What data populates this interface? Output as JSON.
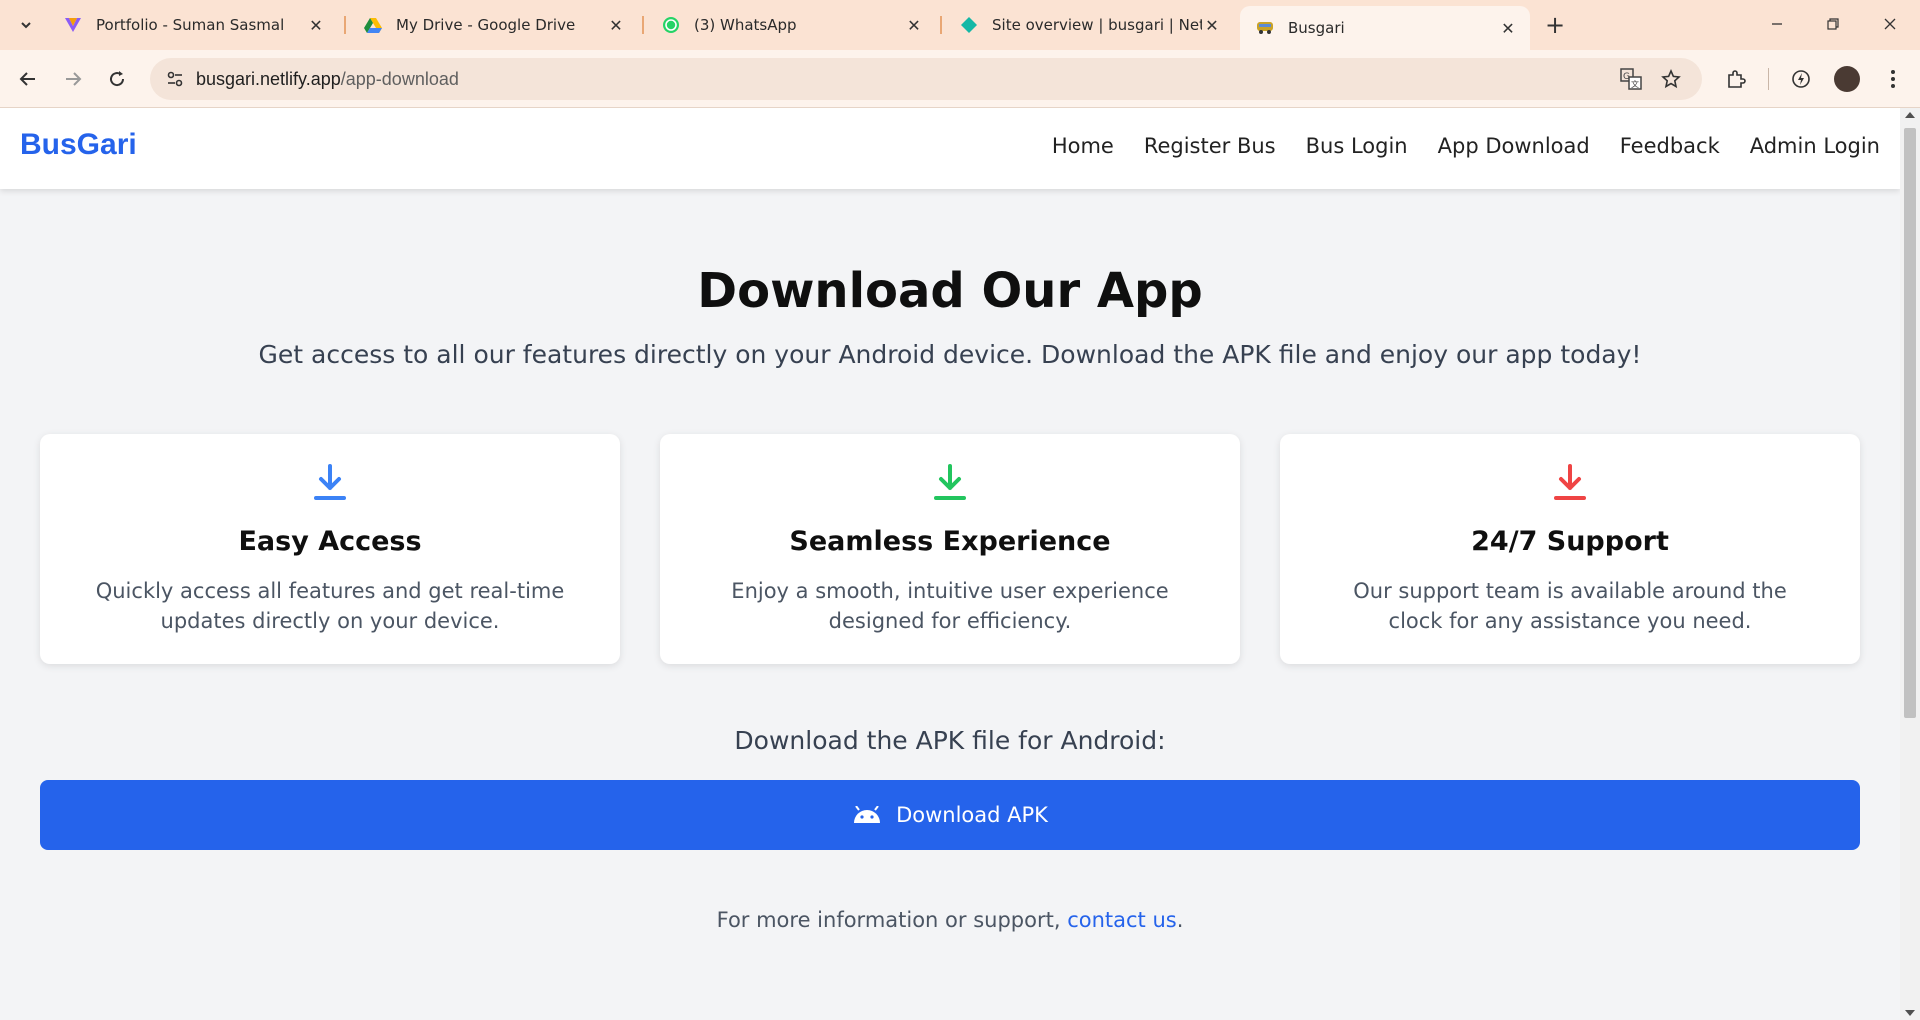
{
  "browser": {
    "tabs": [
      {
        "title": "Portfolio - Suman Sasmal",
        "favicon": "portfolio-v-icon",
        "active": false
      },
      {
        "title": "My Drive - Google Drive",
        "favicon": "google-drive-icon",
        "active": false
      },
      {
        "title": "(3) WhatsApp",
        "favicon": "whatsapp-icon",
        "active": false
      },
      {
        "title": "Site overview | busgari | Netlify",
        "favicon": "netlify-icon",
        "active": false
      },
      {
        "title": "Busgari",
        "favicon": "bus-icon",
        "active": true
      }
    ],
    "url_host": "busgari.netlify.app",
    "url_path": "/app-download"
  },
  "site": {
    "brand": "BusGari",
    "nav": [
      "Home",
      "Register Bus",
      "Bus Login",
      "App Download",
      "Feedback",
      "Admin Login"
    ],
    "hero_title": "Download Our App",
    "hero_subtitle": "Get access to all our features directly on your Android device. Download the APK file and enjoy our app today!",
    "cards": [
      {
        "title": "Easy Access",
        "text": "Quickly access all features and get real-time updates directly on your device.",
        "icon": "download-icon",
        "color": "#3b82f6"
      },
      {
        "title": "Seamless Experience",
        "text": "Enjoy a smooth, intuitive user experience designed for efficiency.",
        "icon": "download-icon",
        "color": "#22c55e"
      },
      {
        "title": "24/7 Support",
        "text": "Our support team is available around the clock for any assistance you need.",
        "icon": "download-icon",
        "color": "#ef4444"
      }
    ],
    "apk_label": "Download the APK file for Android:",
    "apk_button": "Download APK",
    "footer_prefix": "For more information or support, ",
    "footer_link": "contact us",
    "footer_suffix": ".",
    "colors": {
      "primary": "#2563eb",
      "tab_bar": "#fbe3d3"
    }
  }
}
